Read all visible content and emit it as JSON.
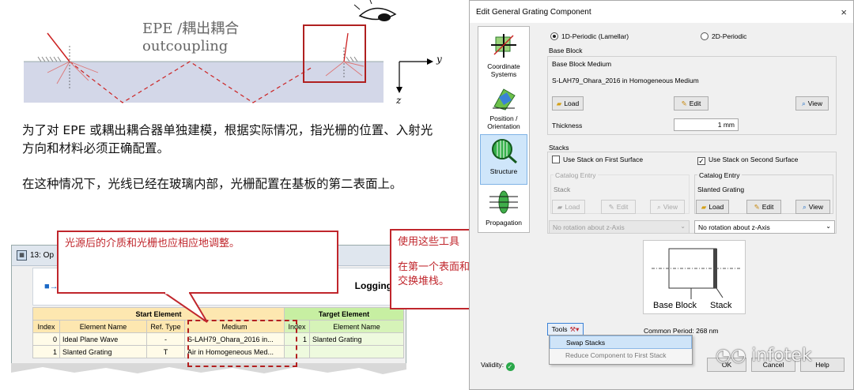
{
  "slide": {
    "diagram_title": [
      "EPE /耦出耦合",
      "outcoupling"
    ],
    "axis_y": "y",
    "axis_z": "z",
    "para1": "为了对 EPE 或耦出耦合器单独建模，根据实际情况，指光栅的位置、入射光方向和材料必须正确配置。",
    "para2": "在这种情况下，光线已经在玻璃内部，光栅配置在基板的第二表面上。"
  },
  "snippet": {
    "window_title": "13: Op",
    "toolbar_label": "Logging",
    "group_source": "Start Element",
    "group_target": "Target Element",
    "columns": [
      "Index",
      "Element Name",
      "Ref. Type",
      "Medium",
      "Index",
      "Element Name"
    ],
    "rows": [
      [
        "0",
        "Ideal Plane Wave",
        "-",
        "S-LAH79_Ohara_2016 in...",
        "1",
        "Slanted Grating"
      ],
      [
        "1",
        "Slanted Grating",
        "T",
        "Air in Homogeneous Med...",
        "",
        ""
      ]
    ]
  },
  "callouts": {
    "c1": "光源后的介质和光栅也应相应地调整。",
    "c2_line1": "使用这些工具",
    "c2_line2": "在第一个表面和第二个表面之间快速交换堆栈。"
  },
  "dialog": {
    "title": "Edit General Grating Component",
    "close": "×",
    "nav": [
      {
        "label": "Coordinate Systems"
      },
      {
        "label": "Position / Orientation"
      },
      {
        "label": "Structure"
      },
      {
        "label": "Propagation"
      }
    ],
    "radio_1d": "1D-Periodic (Lamellar)",
    "radio_2d": "2D-Periodic",
    "base_block": "Base Block",
    "base_block_medium": "Base Block Medium",
    "medium_value": "S-LAH79_Ohara_2016 in Homogeneous Medium",
    "load": "Load",
    "edit": "Edit",
    "view": "View",
    "thickness_label": "Thickness",
    "thickness_value": "1 mm",
    "stacks": "Stacks",
    "use_first": "Use Stack on First Surface",
    "use_second": "Use Stack on Second Surface",
    "catalog_entry": "Catalog Entry",
    "stack_left": "Stack",
    "stack_right": "Slanted Grating",
    "rotation_left": "No rotation about z-Axis",
    "rotation_right": "No rotation about z-Axis",
    "preview_base": "Base Block",
    "preview_stack": "Stack",
    "tools": "Tools",
    "common_period": "Common Period: 268 nm",
    "menu_swap": "Swap Stacks",
    "menu_reduce": "Reduce Component to First Stack",
    "validity": "Validity:",
    "ok": "OK",
    "cancel": "Cancel",
    "help": "Help",
    "watermark": "infotek"
  }
}
